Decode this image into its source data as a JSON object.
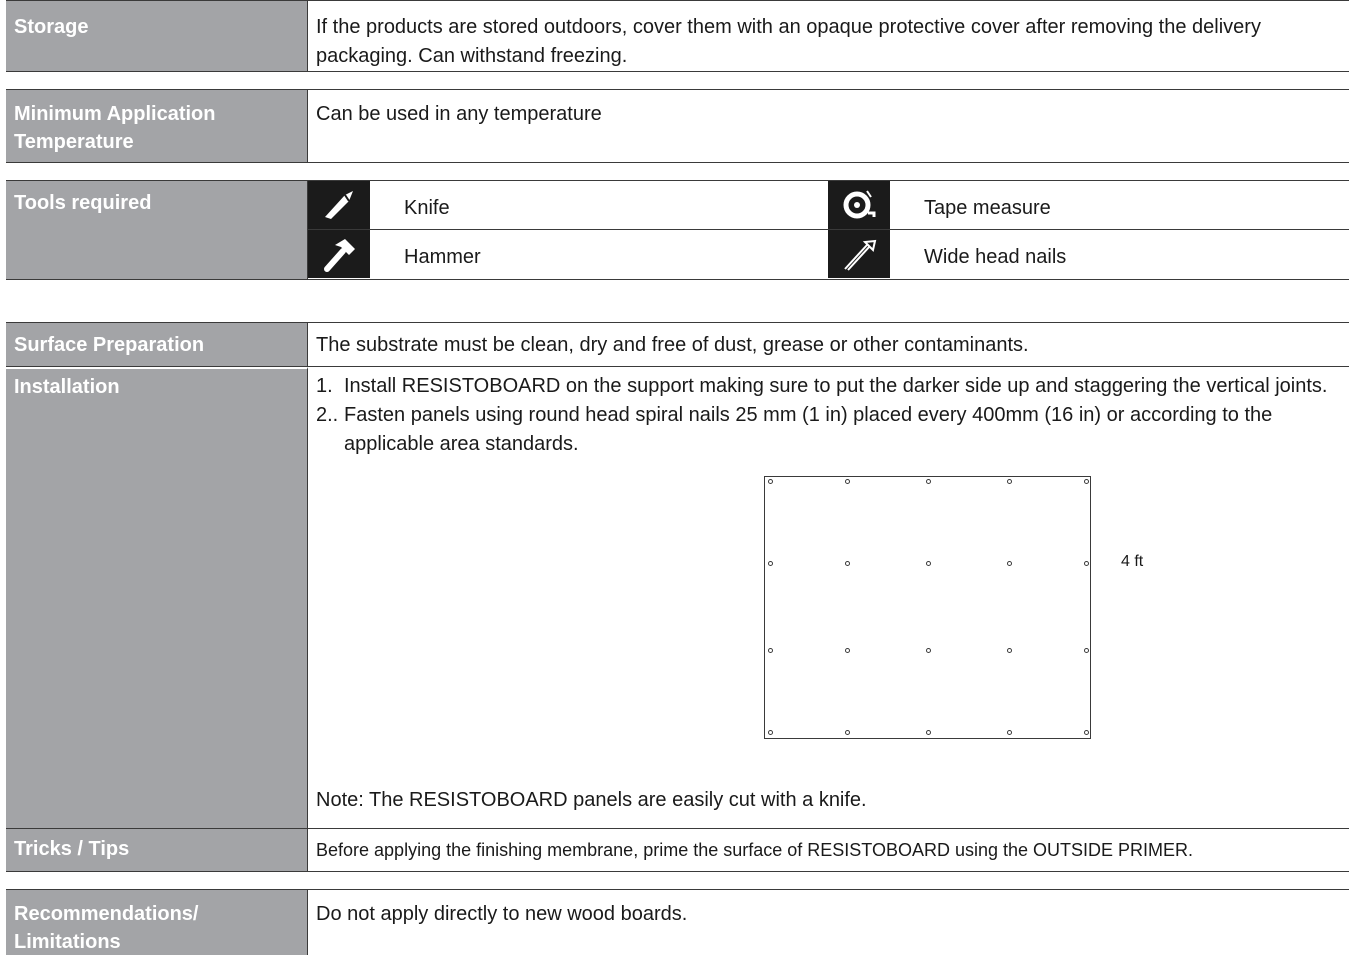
{
  "storage": {
    "label": "Storage",
    "text": "If the products are stored outdoors, cover them with an opaque protective cover after removing the delivery packaging. Can withstand freezing."
  },
  "min_temp": {
    "label": "Minimum Application Temperature",
    "text": "Can be used in any temperature"
  },
  "tools": {
    "label": "Tools required",
    "items": [
      {
        "name": "Knife",
        "icon": "knife-icon"
      },
      {
        "name": "Tape measure",
        "icon": "tape-measure-icon"
      },
      {
        "name": "Hammer",
        "icon": "hammer-icon"
      },
      {
        "name": "Wide head nails",
        "icon": "nail-icon"
      }
    ]
  },
  "surface_prep": {
    "label": "Surface Preparation",
    "text": "The substrate must be clean, dry and free of dust, grease or other contaminants."
  },
  "installation": {
    "label": "Installation",
    "steps": [
      {
        "num": "1.",
        "text": "Install RESISTOBOARD on the support making sure to put the darker side up and staggering the vertical joints."
      },
      {
        "num": "2..",
        "text": "Fasten panels using round head spiral nails 25 mm (1 in) placed every 400mm (16 in) or according to the applicable area standards."
      }
    ],
    "diagram_dimension": "4 ft",
    "note": "Note: The RESISTOBOARD panels are easily cut with a knife."
  },
  "tips": {
    "label": "Tricks / Tips",
    "text": "Before applying the finishing membrane, prime the surface of RESISTOBOARD using the OUTSIDE PRIMER."
  },
  "recommendations": {
    "label": "Recommendations/ Limitations",
    "text": "Do not apply directly to new wood boards."
  },
  "colors": {
    "label_bg": "#a3a4a7",
    "icon_bg": "#1b1b1b",
    "border": "#3a3a3a"
  }
}
